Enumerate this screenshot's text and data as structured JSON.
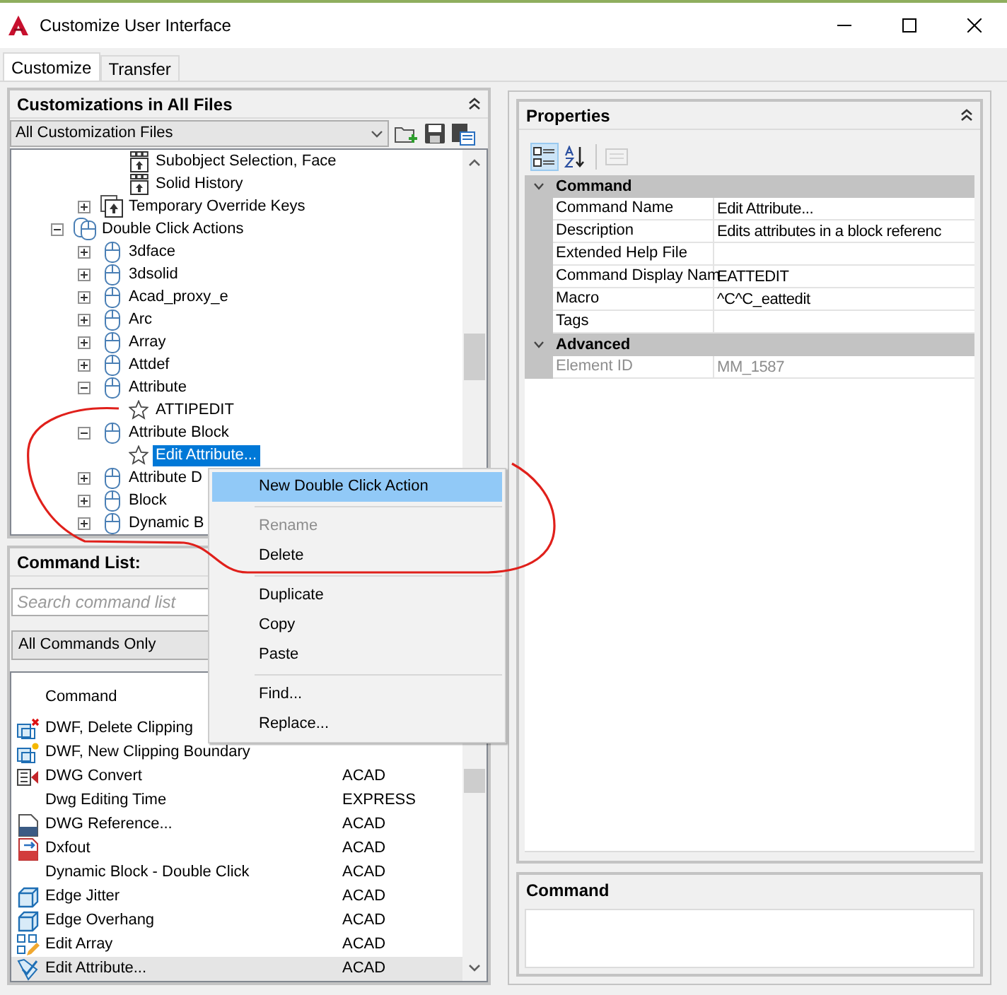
{
  "window": {
    "title": "Customize User Interface"
  },
  "tabs": [
    {
      "label": "Customize",
      "selected": true
    },
    {
      "label": "Transfer",
      "selected": false
    }
  ],
  "customizations_panel": {
    "title": "Customizations in All Files",
    "file_filter": "All Customization Files",
    "tree": [
      {
        "children": [
          {
            "children": [
              {
                "label": "Subobject Selection, Face",
                "kind": "shortcut",
                "selected": false
              },
              {
                "label": "Solid History",
                "kind": "shortcut",
                "selected": false
              }
            ]
          },
          {
            "label": "Temporary Override Keys",
            "kind": "key-group",
            "expanded": false,
            "selected": false
          }
        ]
      },
      {
        "label": "Double Click Actions",
        "kind": "mouse-group",
        "expanded": true,
        "selected": false,
        "children": [
          {
            "label": "3dface",
            "kind": "mouse",
            "expanded": false,
            "selected": false
          },
          {
            "label": "3dsolid",
            "kind": "mouse",
            "expanded": false,
            "selected": false
          },
          {
            "label": "Acad_proxy_e",
            "kind": "mouse",
            "expanded": false,
            "selected": false
          },
          {
            "label": "Arc",
            "kind": "mouse",
            "expanded": false,
            "selected": false
          },
          {
            "label": "Array",
            "kind": "mouse",
            "expanded": false,
            "selected": false
          },
          {
            "label": "Attdef",
            "kind": "mouse",
            "expanded": false,
            "selected": false
          },
          {
            "label": "Attribute",
            "kind": "mouse",
            "expanded": true,
            "selected": false,
            "children": [
              {
                "label": "ATTIPEDIT",
                "kind": "star",
                "selected": false
              }
            ]
          },
          {
            "label": "Attribute Block",
            "kind": "mouse",
            "expanded": true,
            "selected": false,
            "children": [
              {
                "label": "Edit Attribute...",
                "kind": "star",
                "selected": true
              }
            ]
          },
          {
            "label": "Attribute D",
            "kind": "mouse",
            "expanded": false,
            "selected": false
          },
          {
            "label": "Block",
            "kind": "mouse",
            "expanded": false,
            "selected": false
          },
          {
            "label": "Dynamic B",
            "kind": "mouse",
            "expanded": false,
            "selected": false
          }
        ]
      }
    ]
  },
  "command_list_panel": {
    "title": "Command List:",
    "search": {
      "placeholder": "Search command list"
    },
    "filter": "All Commands Only",
    "columns": [
      "Command"
    ],
    "rows": [
      {
        "name": "DWF, Delete Clipping",
        "kind": "clip-delete",
        "selected": false
      },
      {
        "name": "DWF, New Clipping Boundary",
        "kind": "clip-new",
        "selected": false
      },
      {
        "name": "DWG Convert",
        "source": "ACAD",
        "kind": "convert",
        "selected": false
      },
      {
        "name": "Dwg Editing Time",
        "source": "EXPRESS",
        "kind": "none",
        "selected": false
      },
      {
        "name": "DWG Reference...",
        "source": "ACAD",
        "kind": "document",
        "selected": false
      },
      {
        "name": "Dxfout",
        "source": "ACAD",
        "kind": "export",
        "selected": false
      },
      {
        "name": "Dynamic Block - Double Click",
        "source": "ACAD",
        "kind": "none",
        "selected": false
      },
      {
        "name": "Edge Jitter",
        "source": "ACAD",
        "kind": "cube",
        "selected": false
      },
      {
        "name": "Edge Overhang",
        "source": "ACAD",
        "kind": "cube",
        "selected": false
      },
      {
        "name": "Edit Array",
        "source": "ACAD",
        "kind": "grid",
        "selected": false
      },
      {
        "name": "Edit Attribute...",
        "source": "ACAD",
        "kind": "tag",
        "selected": true
      }
    ]
  },
  "properties_panel": {
    "title": "Properties",
    "toolbar": [
      {
        "kind": "categorized",
        "selected": true,
        "disabled": false
      },
      {
        "kind": "alphabetical",
        "selected": false,
        "disabled": false
      },
      {
        "kind": "pages",
        "selected": false,
        "disabled": true
      }
    ],
    "sections": [
      {
        "title": "Command",
        "expanded": true,
        "rows": [
          {
            "name": "Command Name",
            "value": "Edit Attribute...",
            "disabled": false
          },
          {
            "name": "Description",
            "value": "Edits attributes in a block referenc",
            "disabled": false
          },
          {
            "name": "Extended Help File",
            "disabled": false
          },
          {
            "name": "Command Display Nam",
            "value": "EATTEDIT",
            "disabled": false
          },
          {
            "name": "Macro",
            "value": "^C^C_eattedit",
            "disabled": false
          },
          {
            "name": "Tags",
            "disabled": false
          }
        ]
      },
      {
        "title": "Advanced",
        "expanded": true,
        "rows": [
          {
            "name": "Element ID",
            "value": "MM_1587",
            "disabled": true
          }
        ]
      }
    ]
  },
  "info_panel": {
    "title": "Command"
  },
  "context_menu": {
    "items": [
      {
        "kind": "item",
        "label": "New Double Click Action",
        "highlighted": true,
        "disabled": false
      },
      {
        "kind": "separator"
      },
      {
        "kind": "item",
        "label": "Rename",
        "highlighted": false,
        "disabled": true
      },
      {
        "kind": "item",
        "label": "Delete",
        "highlighted": false,
        "disabled": false
      },
      {
        "kind": "separator"
      },
      {
        "kind": "item",
        "label": "Duplicate",
        "highlighted": false,
        "disabled": false
      },
      {
        "kind": "item",
        "label": "Copy",
        "highlighted": false,
        "disabled": false
      },
      {
        "kind": "item",
        "label": "Paste",
        "highlighted": false,
        "disabled": false
      },
      {
        "kind": "separator"
      },
      {
        "kind": "item",
        "label": "Find...",
        "highlighted": false,
        "disabled": false
      },
      {
        "kind": "item",
        "label": "Replace...",
        "highlighted": false,
        "disabled": false
      }
    ]
  }
}
